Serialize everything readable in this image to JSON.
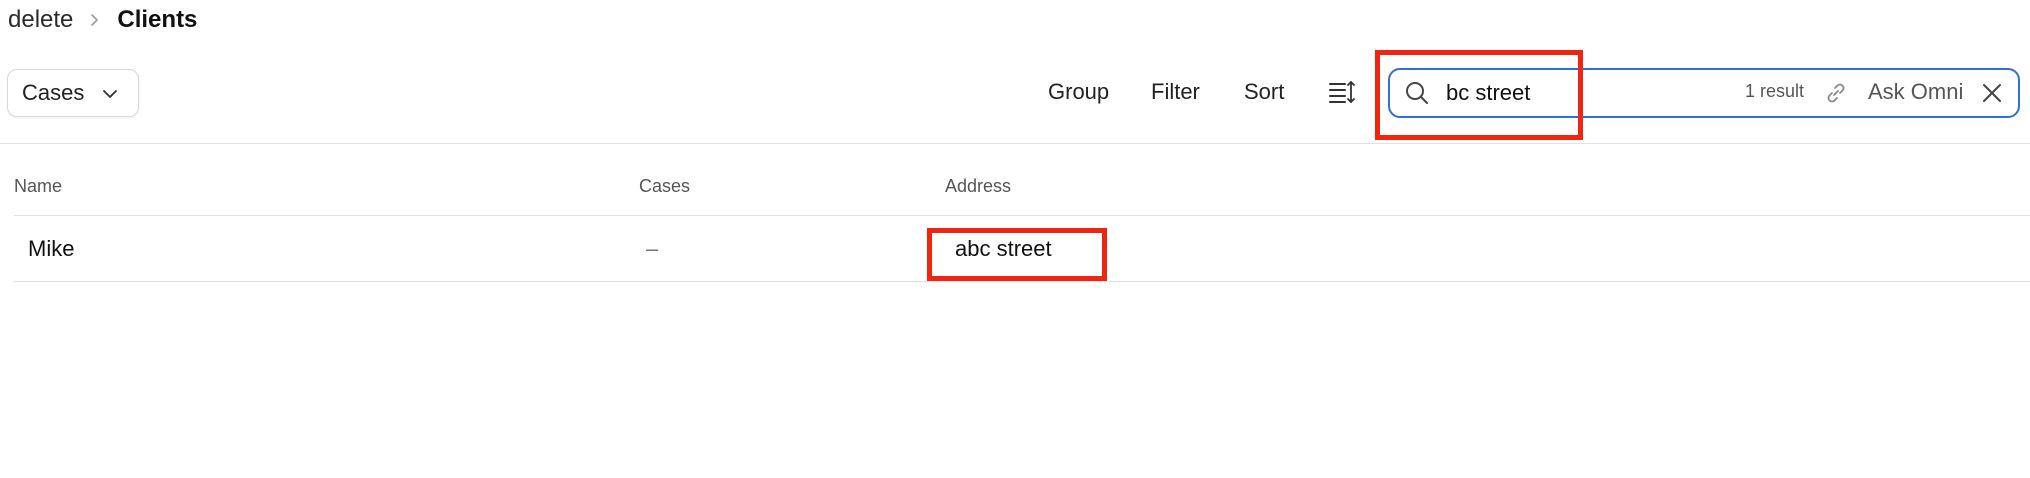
{
  "breadcrumb": {
    "parent": "delete",
    "current": "Clients"
  },
  "toolbar": {
    "view_label": "Cases",
    "group_label": "Group",
    "filter_label": "Filter",
    "sort_label": "Sort"
  },
  "search": {
    "value": "bc street",
    "result_count": "1 result",
    "ask_label": "Ask Omni"
  },
  "table": {
    "columns": [
      "Name",
      "Cases",
      "Address"
    ],
    "rows": [
      {
        "name": "Mike",
        "cases": "–",
        "address": "abc street"
      }
    ]
  },
  "colors": {
    "accent": "#2f6fd1",
    "highlight": "#f0250f"
  },
  "icons": {
    "breadcrumb_separator": "chevron-right-icon",
    "view_dropdown": "chevron-down-icon",
    "density": "row-density-icon",
    "search": "search-icon",
    "link": "link-icon",
    "close": "close-icon"
  }
}
